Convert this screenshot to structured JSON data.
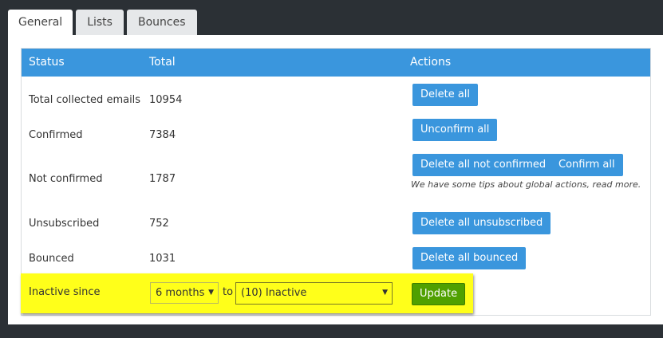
{
  "tabs": [
    "General",
    "Lists",
    "Bounces"
  ],
  "table": {
    "headers": {
      "status": "Status",
      "total": "Total",
      "actions": "Actions"
    },
    "rows": [
      {
        "status": "Total collected emails",
        "total": "10954",
        "actions": [
          "Delete all"
        ]
      },
      {
        "status": "Confirmed",
        "total": "7384",
        "actions": [
          "Unconfirm all"
        ]
      },
      {
        "status": "Not confirmed",
        "total": "1787",
        "actions": [
          "Delete all not confirmed",
          "Confirm all"
        ],
        "note": "We have some tips about global actions, read more."
      },
      {
        "status": "Unsubscribed",
        "total": "752",
        "actions": [
          "Delete all unsubscribed"
        ]
      },
      {
        "status": "Bounced",
        "total": "1031",
        "actions": [
          "Delete all bounced"
        ]
      }
    ],
    "inactive": {
      "label": "Inactive since",
      "period_value": "6 months",
      "to_label": "to",
      "status_value": "(10) Inactive",
      "button": "Update"
    }
  },
  "colors": {
    "header_blue": "#3a96dd",
    "highlight": "#ffff1a",
    "update_green": "#50a000"
  }
}
